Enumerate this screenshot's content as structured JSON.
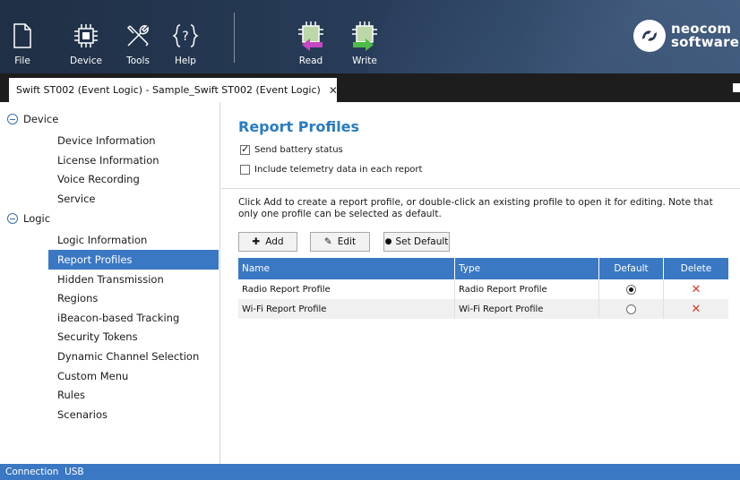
{
  "toolbar": {
    "buttons": [
      {
        "label": "File",
        "icon": "file-icon"
      },
      {
        "label": "Device",
        "icon": "chip-icon"
      },
      {
        "label": "Tools",
        "icon": "tools-icon"
      },
      {
        "label": "Help",
        "icon": "help-icon"
      },
      {
        "label": "Read",
        "icon": "read-chip-icon"
      },
      {
        "label": "Write",
        "icon": "write-chip-icon"
      }
    ],
    "logo": {
      "line1": "neocom",
      "line2": "software"
    }
  },
  "tab": {
    "title": "Swift ST002 (Event Logic) - Sample_Swift ST002 (Event Logic)",
    "close": "✕"
  },
  "tree": {
    "groups": [
      {
        "label": "Device",
        "items": [
          "Device Information",
          "License Information",
          "Voice Recording",
          "Service"
        ]
      },
      {
        "label": "Logic",
        "items": [
          "Logic Information",
          "Report Profiles",
          "Hidden Transmission",
          "Regions",
          "iBeacon-based Tracking",
          "Security Tokens",
          "Dynamic Channel Selection",
          "Custom Menu",
          "Rules",
          "Scenarios"
        ]
      }
    ],
    "selected": "Report Profiles"
  },
  "main": {
    "title": "Report Profiles",
    "send_battery": {
      "label": "Send battery status",
      "checked": true
    },
    "include_telemetry": {
      "label": "Include telemetry data in each report",
      "checked": false
    },
    "description": "Click Add to create a report profile, or double-click an existing profile to open it for editing. Note that only one profile can be selected as default.",
    "buttons": {
      "add": "Add",
      "edit": "Edit",
      "set_default": "Set Default"
    },
    "table": {
      "columns": [
        "Name",
        "Type",
        "Default",
        "Delete"
      ],
      "rows": [
        {
          "name": "Radio Report Profile",
          "type": "Radio Report Profile",
          "default": true
        },
        {
          "name": "Wi-Fi Report Profile",
          "type": "Wi-Fi Report Profile",
          "default": false
        }
      ]
    }
  },
  "status": {
    "text": "Connection  USB"
  },
  "colors": {
    "accent": "#3a78c3",
    "title": "#2a7bc0",
    "delete": "#d33b2e",
    "toolbar": "#263a55"
  }
}
